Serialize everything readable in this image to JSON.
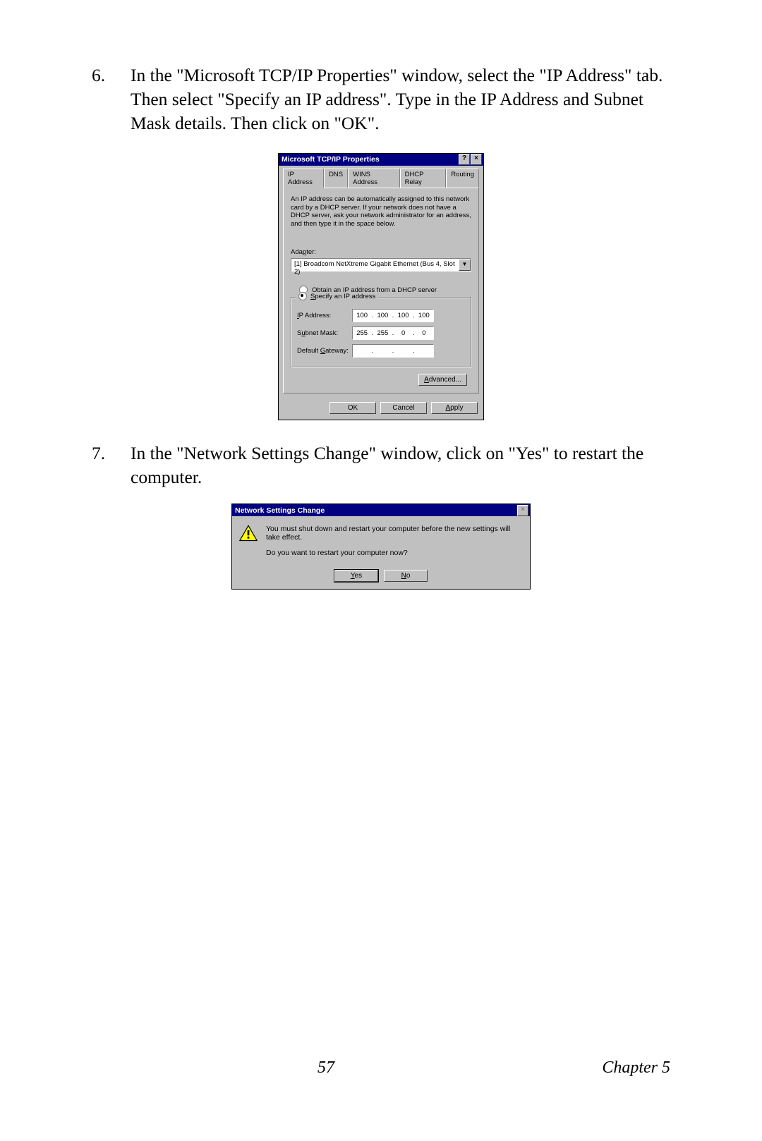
{
  "steps": {
    "s6": {
      "num": "6.",
      "text": "In the \"Microsoft TCP/IP Properties\" window, select the \"IP Address\" tab. Then select \"Specify an IP address\". Type in the IP Address and Subnet Mask details. Then click on \"OK\"."
    },
    "s7": {
      "num": "7.",
      "text": "In the \"Network Settings Change\" window, click on \"Yes\" to restart the computer."
    }
  },
  "tcpip": {
    "title": "Microsoft TCP/IP Properties",
    "help_btn": "?",
    "close_btn": "×",
    "tabs": {
      "ip": "IP Address",
      "dns": "DNS",
      "wins": "WINS Address",
      "dhcp": "DHCP Relay",
      "routing": "Routing"
    },
    "desc": "An IP address can be automatically assigned to this network card by a DHCP server. If your network does not have a DHCP server, ask your network administrator for an address, and then type it in the space below.",
    "adapter_label": "Adapter:",
    "adapter_value": "[1] Broadcom NetXtreme Gigabit Ethernet (Bus 4, Slot 2)",
    "combo_arrow": "▼",
    "radio_dhcp": "Obtain an IP address from a DHCP server",
    "radio_specify": "Specify an IP address",
    "ip_label": "IP Address:",
    "ip_value": [
      "100",
      "100",
      "100",
      "100"
    ],
    "mask_label": "Subnet Mask:",
    "mask_value": [
      "255",
      "255",
      "0",
      "0"
    ],
    "gw_label": "Default Gateway:",
    "gw_value": [
      "",
      "",
      "",
      ""
    ],
    "advanced": "Advanced...",
    "ok": "OK",
    "cancel": "Cancel",
    "apply": "Apply"
  },
  "msgbox": {
    "title": "Network Settings Change",
    "close_btn": "×",
    "line1": "You must shut down and restart your computer before the new settings will take effect.",
    "line2": "Do you want to restart your computer now?",
    "yes": "Yes",
    "no": "No"
  },
  "footer": {
    "page": "57",
    "chapter": "Chapter 5"
  }
}
